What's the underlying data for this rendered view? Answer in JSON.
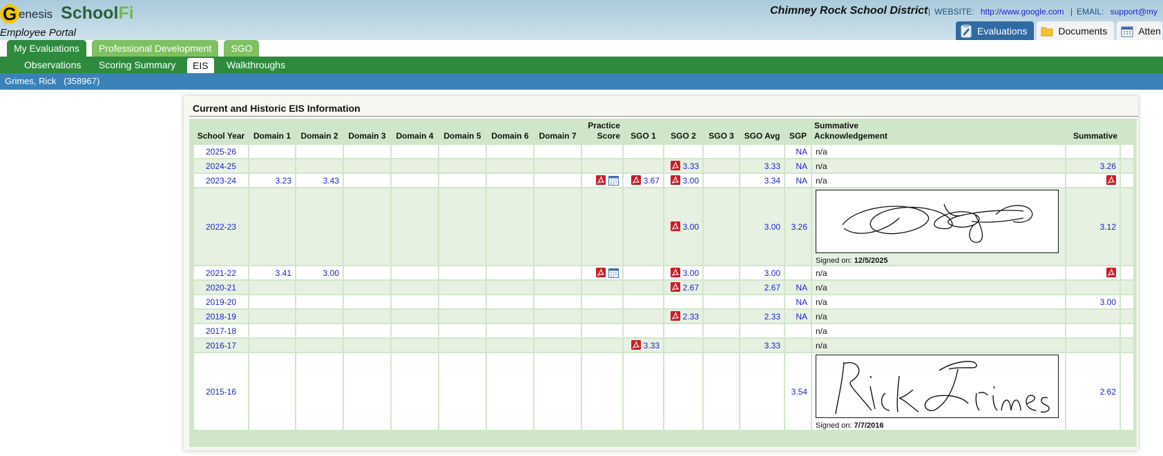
{
  "brand": {
    "g": "G",
    "enesis": "enesis",
    "school": "School",
    "fi": "Fi"
  },
  "portal_label": "Employee Portal",
  "district_name": "Chimney Rock School District",
  "contact": {
    "website_label": "WEBSITE:",
    "website_url": "http://www.google.com",
    "email_label": "EMAIL:",
    "email_value": "support@my"
  },
  "app_tabs": [
    {
      "label": "Evaluations",
      "icon": "clipboard-icon",
      "active": true
    },
    {
      "label": "Documents",
      "icon": "folder-icon",
      "active": false
    },
    {
      "label": "Atten",
      "icon": "calendar-icon",
      "active": false
    }
  ],
  "module_tabs": [
    {
      "label": "My Evaluations",
      "active": true
    },
    {
      "label": "Professional Development",
      "active": false
    },
    {
      "label": "SGO",
      "active": false
    }
  ],
  "sub_tabs": [
    {
      "label": "Observations",
      "active": false
    },
    {
      "label": "Scoring Summary",
      "active": false
    },
    {
      "label": "EIS",
      "active": true
    },
    {
      "label": "Walkthroughs",
      "active": false
    }
  ],
  "user": {
    "name": "Grimes, Rick",
    "id": "(358967)"
  },
  "panel_title": "Current and Historic EIS Information",
  "table": {
    "headers": {
      "school_year": "School Year",
      "d1": "Domain 1",
      "d2": "Domain 2",
      "d3": "Domain 3",
      "d4": "Domain 4",
      "d5": "Domain 5",
      "d6": "Domain 6",
      "d7": "Domain 7",
      "practice_1": "Practice",
      "practice_2": "Score",
      "sgo1": "SGO 1",
      "sgo2": "SGO 2",
      "sgo3": "SGO 3",
      "sgo_avg": "SGO Avg",
      "sgp": "SGP",
      "ack_1": "Summative",
      "ack_2": "Acknowledgement",
      "summative": "Summative"
    },
    "signed_label": "Signed on:",
    "rows": [
      {
        "year": "2025-26",
        "d1": "",
        "d2": "",
        "practice_pdf": false,
        "sgo1": "",
        "sgo1_pdf": false,
        "sgo2": "",
        "sgo2_pdf": false,
        "sgo_avg": "",
        "sgp": "NA",
        "ack": "n/a",
        "summative": "",
        "summative_pdf": false
      },
      {
        "year": "2024-25",
        "d1": "",
        "d2": "",
        "practice_pdf": false,
        "sgo1": "",
        "sgo1_pdf": false,
        "sgo2": "3.33",
        "sgo2_pdf": true,
        "sgo_avg": "3.33",
        "sgp": "NA",
        "ack": "n/a",
        "summative": "3.26",
        "summative_pdf": false
      },
      {
        "year": "2023-24",
        "d1": "3.23",
        "d2": "3.43",
        "practice_pdf": true,
        "sgo1": "3.67",
        "sgo1_pdf": true,
        "sgo2": "3.00",
        "sgo2_pdf": true,
        "sgo_avg": "3.34",
        "sgp": "NA",
        "ack": "n/a",
        "summative": "",
        "summative_pdf": true
      },
      {
        "year": "2022-23",
        "d1": "",
        "d2": "",
        "practice_pdf": false,
        "sgo1": "",
        "sgo1_pdf": false,
        "sgo2": "3.00",
        "sgo2_pdf": true,
        "sgo_avg": "3.00",
        "sgp": "3.26",
        "ack": "",
        "signed_date": "12/5/2025",
        "signature": "scribble",
        "summative": "3.12",
        "summative_pdf": false
      },
      {
        "year": "2021-22",
        "d1": "3.41",
        "d2": "3.00",
        "practice_pdf": true,
        "sgo1": "",
        "sgo1_pdf": false,
        "sgo2": "3.00",
        "sgo2_pdf": true,
        "sgo_avg": "3.00",
        "sgp": "",
        "ack": "n/a",
        "summative": "",
        "summative_pdf": true
      },
      {
        "year": "2020-21",
        "d1": "",
        "d2": "",
        "practice_pdf": false,
        "sgo1": "",
        "sgo1_pdf": false,
        "sgo2": "2.67",
        "sgo2_pdf": true,
        "sgo_avg": "2.67",
        "sgp": "NA",
        "ack": "n/a",
        "summative": "",
        "summative_pdf": false
      },
      {
        "year": "2019-20",
        "d1": "",
        "d2": "",
        "practice_pdf": false,
        "sgo1": "",
        "sgo1_pdf": false,
        "sgo2": "",
        "sgo2_pdf": false,
        "sgo_avg": "",
        "sgp": "NA",
        "ack": "n/a",
        "summative": "3.00",
        "summative_pdf": false
      },
      {
        "year": "2018-19",
        "d1": "",
        "d2": "",
        "practice_pdf": false,
        "sgo1": "",
        "sgo1_pdf": false,
        "sgo2": "2.33",
        "sgo2_pdf": true,
        "sgo_avg": "2.33",
        "sgp": "NA",
        "ack": "n/a",
        "summative": "",
        "summative_pdf": false
      },
      {
        "year": "2017-18",
        "d1": "",
        "d2": "",
        "practice_pdf": false,
        "sgo1": "",
        "sgo1_pdf": false,
        "sgo2": "",
        "sgo2_pdf": false,
        "sgo_avg": "",
        "sgp": "",
        "ack": "n/a",
        "summative": "",
        "summative_pdf": false
      },
      {
        "year": "2016-17",
        "d1": "",
        "d2": "",
        "practice_pdf": false,
        "sgo1": "3.33",
        "sgo1_pdf": true,
        "sgo2": "",
        "sgo2_pdf": false,
        "sgo_avg": "3.33",
        "sgp": "",
        "ack": "n/a",
        "summative": "",
        "summative_pdf": false
      },
      {
        "year": "2015-16",
        "d1": "",
        "d2": "",
        "practice_pdf": false,
        "sgo1": "",
        "sgo1_pdf": false,
        "sgo2": "",
        "sgo2_pdf": false,
        "sgo_avg": "",
        "sgp": "3.54",
        "ack": "",
        "signed_date": "7/7/2016",
        "signature": "rick-grimes",
        "summative": "2.62",
        "summative_pdf": false
      }
    ]
  },
  "colors": {
    "header_bg": "#a9cadb",
    "module_active": "#2e8b3e",
    "module_inactive": "#7fc060",
    "user_bar": "#3a82b8",
    "table_border": "#cfe7c8",
    "link": "#1a24c8"
  }
}
